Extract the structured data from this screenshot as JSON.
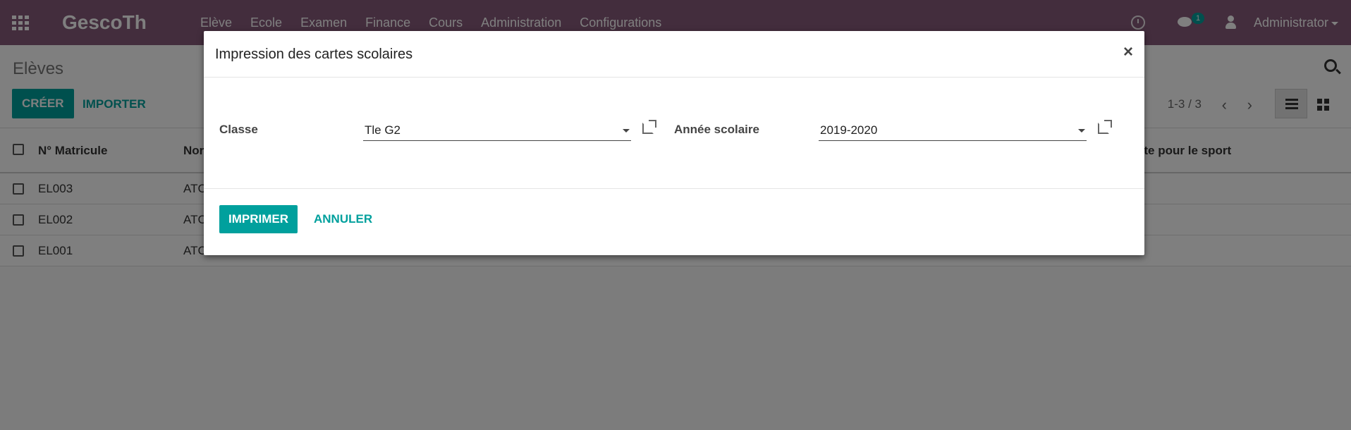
{
  "navbar": {
    "brand": "GescoTh",
    "menu": [
      "Elève",
      "Ecole",
      "Examen",
      "Finance",
      "Cours",
      "Administration",
      "Configurations"
    ],
    "chat_count": "1",
    "user": "Administrator"
  },
  "control": {
    "title": "Elèves",
    "create_label": "CRÉER",
    "import_label": "IMPORTER",
    "pager": "1-3 / 3",
    "prev": "‹",
    "next": "›"
  },
  "table": {
    "headers": [
      "N° Matricule",
      "Nor",
      "pte pour le sport"
    ],
    "rows": [
      {
        "matricule": "EL003",
        "nom": "ATC"
      },
      {
        "matricule": "EL002",
        "nom": "ATC"
      },
      {
        "matricule": "EL001",
        "nom": "ATC"
      }
    ]
  },
  "modal": {
    "title": "Impression des cartes scolaires",
    "close": "×",
    "classe_label": "Classe",
    "classe_value": "Tle G2",
    "annee_label": "Année scolaire",
    "annee_value": "2019-2020",
    "print_label": "IMPRIMER",
    "cancel_label": "ANNULER"
  }
}
